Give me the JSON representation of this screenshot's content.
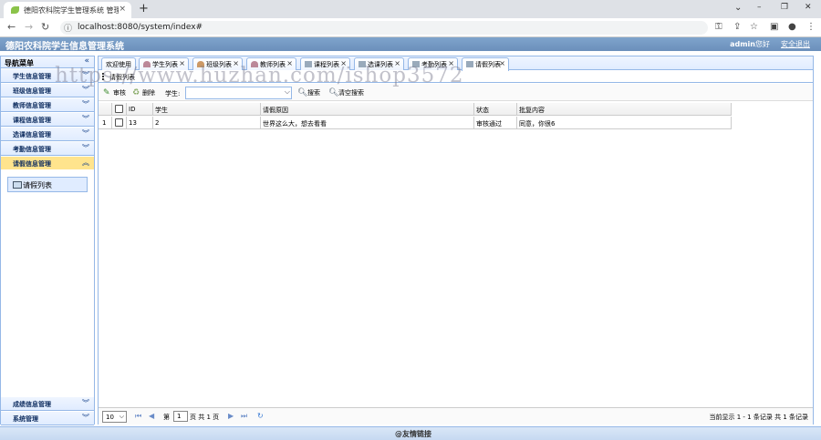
{
  "browser": {
    "tab_title": "德阳农科院学生管理系统 管理员",
    "close": "×",
    "new_tab": "+",
    "url": "localhost:8080/system/index#",
    "min": "–",
    "max": "❐",
    "close_win": "✕"
  },
  "header": {
    "title": "德阳农科院学生信息管理系统",
    "user": "admin",
    "greeting": "您好",
    "logout": "安全退出"
  },
  "nav": {
    "title": "导航菜单",
    "collapse_icon": "«",
    "items": [
      {
        "label": "学生信息管理",
        "expanded": false
      },
      {
        "label": "班级信息管理",
        "expanded": false
      },
      {
        "label": "教师信息管理",
        "expanded": false
      },
      {
        "label": "课程信息管理",
        "expanded": false
      },
      {
        "label": "选课信息管理",
        "expanded": false
      },
      {
        "label": "考勤信息管理",
        "expanded": false
      },
      {
        "label": "请假信息管理",
        "expanded": true
      },
      {
        "label": "成绩信息管理",
        "expanded": false
      },
      {
        "label": "系统管理",
        "expanded": false
      }
    ],
    "active_link": "请假列表"
  },
  "tabs": [
    {
      "label": "欢迎使用",
      "closable": false
    },
    {
      "label": "学生列表",
      "closable": true
    },
    {
      "label": "班级列表",
      "closable": true
    },
    {
      "label": "教师列表",
      "closable": true
    },
    {
      "label": "课程列表",
      "closable": true
    },
    {
      "label": "选课列表",
      "closable": true
    },
    {
      "label": "考勤列表",
      "closable": true
    },
    {
      "label": "请假列表",
      "closable": true,
      "active": true
    }
  ],
  "panel": {
    "title": "请假列表"
  },
  "toolbar": {
    "audit": "审核",
    "delete": "删除",
    "student_label": "学生:",
    "search": "搜索",
    "clear": "清空搜索"
  },
  "grid": {
    "columns": [
      "ID",
      "学生",
      "请假原因",
      "状态",
      "批复内容"
    ],
    "rows": [
      {
        "num": "1",
        "id": "13",
        "student": "2",
        "reason": "世界这么大，想去看看",
        "status": "审核通过",
        "reply": "同意，你很6"
      }
    ]
  },
  "pager": {
    "page_size": "10",
    "page_prefix": "第",
    "page": "1",
    "page_suffix": "页 共 1 页",
    "summary": "当前显示 1 - 1 条记录 共 1 条记录"
  },
  "footer": {
    "text": "@友情链接"
  },
  "watermark": "https://www.huzhan.com/ishop3572",
  "colors": {
    "border": "#95b8e7",
    "header": "#6b8fbb",
    "selected_nav": "#ffe48d"
  }
}
